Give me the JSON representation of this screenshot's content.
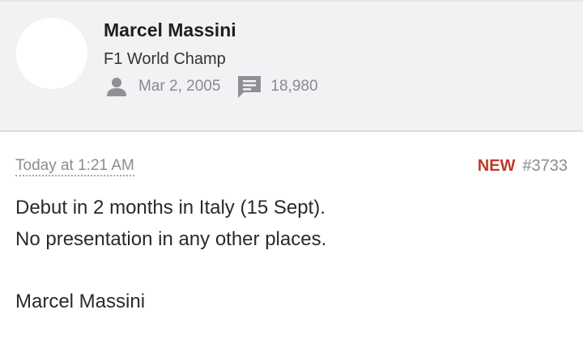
{
  "user": {
    "name": "Marcel Massini",
    "title": "F1 World Champ",
    "joined": "Mar 2, 2005",
    "message_count": "18,980"
  },
  "post": {
    "time": "Today at 1:21 AM",
    "new_label": "NEW",
    "number": "#3733",
    "lines": [
      "Debut in 2 months in Italy (15 Sept).",
      "No presentation in any other places."
    ],
    "signature": "Marcel Massini"
  },
  "icons": {
    "joined": "person-icon",
    "messages": "message-icon"
  },
  "colors": {
    "new_badge": "#c0392b",
    "muted": "#8a8a8f",
    "header_bg": "#f2f2f4"
  }
}
